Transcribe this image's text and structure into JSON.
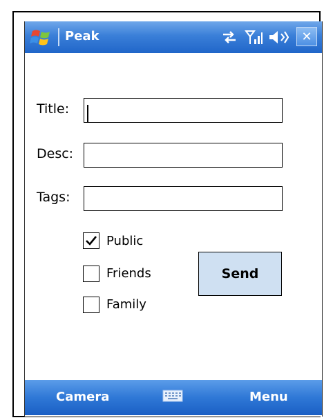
{
  "titlebar": {
    "title": "Peak",
    "icons": [
      "windows-start-icon",
      "connectivity-icon",
      "signal-icon",
      "volume-icon",
      "close-icon"
    ],
    "close_label": "✕"
  },
  "form": {
    "title_label": "Title:",
    "title_value": "",
    "desc_label": "Desc:",
    "desc_value": "",
    "tags_label": "Tags:",
    "tags_value": ""
  },
  "checkboxes": [
    {
      "label": "Public",
      "checked": true
    },
    {
      "label": "Friends",
      "checked": false
    },
    {
      "label": "Family",
      "checked": false
    }
  ],
  "send_label": "Send",
  "softkeys": {
    "left": "Camera",
    "right": "Menu",
    "center_icon": "keyboard-icon"
  },
  "colors": {
    "bar_blue": "#2f78d6",
    "button_fill": "#cfe0f2"
  }
}
